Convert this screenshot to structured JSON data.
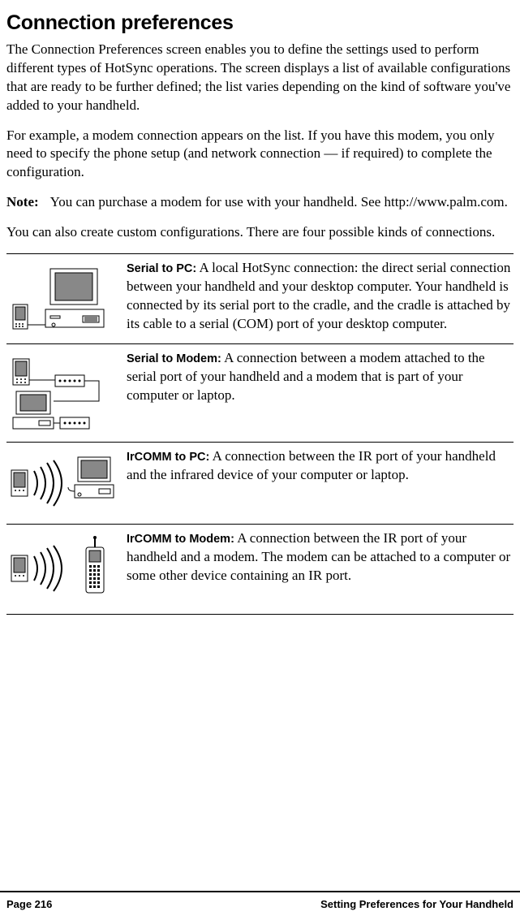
{
  "title": "Connection preferences",
  "intro1": "The Connection Preferences screen enables you to define the settings used to perform different types of HotSync operations. The screen displays a list of available configurations that are ready to be further defined; the list varies depending on the kind of software you've added to your handheld.",
  "intro2": "For example, a modem connection appears on the list. If you have this modem, you only need to specify the phone setup (and network connection — if required) to complete the configuration.",
  "note": {
    "label": "Note:",
    "body": "You can purchase a modem for use with your handheld. See http://www.palm.com."
  },
  "intro3": "You can also create custom configurations. There are four possible kinds of connections.",
  "connections": [
    {
      "label": "Serial to PC:",
      "desc": " A local HotSync connection: the direct serial connection between your handheld and your desktop computer. Your handheld is connected by its serial port to the cradle, and the cradle is attached by its cable to a serial (COM) port of your desktop computer."
    },
    {
      "label": "Serial to Modem:",
      "desc": " A connection between a modem attached to the serial port of your handheld and a modem that is part of your computer or laptop."
    },
    {
      "label": "IrCOMM to PC:",
      "desc": " A connection between the IR port of your handheld and the infrared device of your computer or laptop."
    },
    {
      "label": "IrCOMM to Modem:",
      "desc": " A connection between the IR port of your handheld and a modem. The modem can be attached to a computer or some other device containing an IR port."
    }
  ],
  "footer": {
    "left": "Page 216",
    "right": "Setting Preferences for Your Handheld"
  }
}
